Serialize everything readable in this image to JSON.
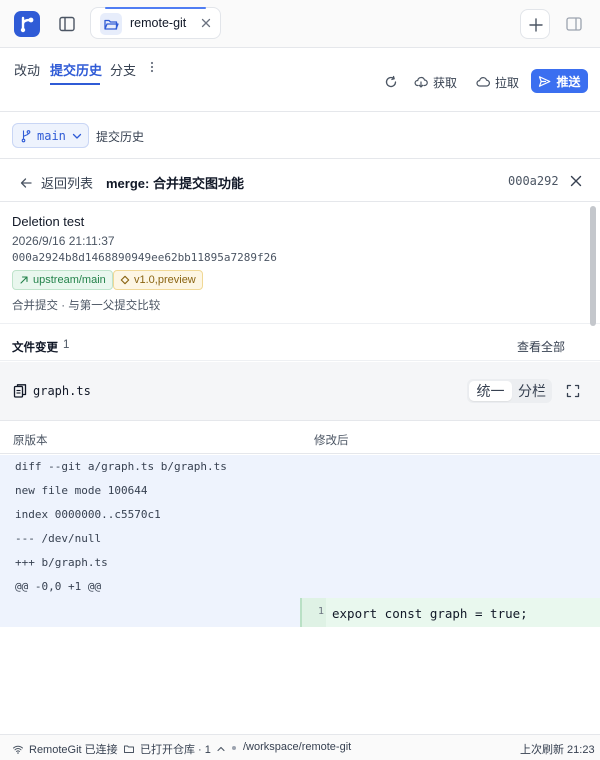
{
  "window": {
    "tab_title": "remote-git"
  },
  "nav": {
    "tabs": [
      "改动",
      "提交历史",
      "分支"
    ],
    "actions": {
      "fetch": "获取",
      "pull": "拉取",
      "push": "推送"
    }
  },
  "branch": {
    "name": "main",
    "breadcrumb": "提交历史"
  },
  "detail": {
    "back_label": "返回列表",
    "title": "merge: 合并提交图功能",
    "short_hash": "000a292"
  },
  "commit": {
    "message": "Deletion test",
    "date": "2026/9/16 21:11:37",
    "hash": "000a2924b8d1468890949ee62bb11895a7289f26",
    "refs": [
      "upstream/main",
      "v1.0,preview"
    ],
    "note": "合并提交 · 与第一父提交比较"
  },
  "files": {
    "title": "文件变更",
    "count": "1",
    "view_all": "查看全部"
  },
  "file": {
    "name": "graph.ts",
    "view_unified": "统一",
    "view_split": "分栏",
    "col_left": "原版本",
    "col_right": "修改后",
    "meta_lines": [
      "diff --git a/graph.ts b/graph.ts",
      "new file mode 100644",
      "index 0000000..c5570c1",
      "--- /dev/null",
      "+++ b/graph.ts",
      "@@ -0,0 +1 @@"
    ],
    "added_line_number": "1",
    "added_line": "export const graph = true;"
  },
  "status": {
    "connection": "RemoteGit 已连接",
    "repos": "已打开仓库 · 1",
    "path": "/workspace/remote-git",
    "last_refresh": "上次刷新 21:23"
  },
  "colors": {
    "accent": "#2f5bd6",
    "push_button": "#3b6ff0",
    "diff_meta_bg": "#eef3fd",
    "diff_add_bg": "#e9f8ee"
  },
  "icons": {
    "logo": "branch-logo-icon",
    "sidebar": "sidebar-toggle-icon",
    "folder": "folder-open-icon",
    "close": "close-icon",
    "add": "plus-icon",
    "panel": "panel-right-icon",
    "more": "more-vertical-icon",
    "refresh": "refresh-icon",
    "fetch": "cloud-download-icon",
    "pull": "cloud-icon",
    "push": "send-icon",
    "branch": "git-branch-icon",
    "back": "arrow-left-icon",
    "file": "file-copy-icon",
    "expand": "expand-icon"
  }
}
